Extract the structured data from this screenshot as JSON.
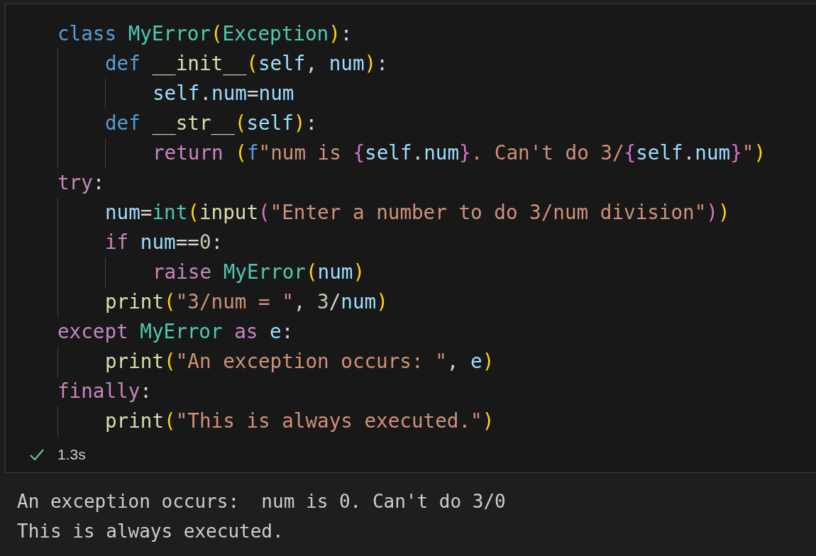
{
  "cell": {
    "lines": [
      {
        "tokens": [
          {
            "kind": "keyword",
            "text": "class "
          },
          {
            "kind": "class",
            "text": "MyError"
          },
          {
            "kind": "paren1",
            "text": "("
          },
          {
            "kind": "class",
            "text": "Exception"
          },
          {
            "kind": "paren1",
            "text": ")"
          },
          {
            "kind": "plain",
            "text": ":"
          }
        ],
        "children": [
          {
            "tokens": [
              {
                "kind": "keyword",
                "text": "def "
              },
              {
                "kind": "function",
                "text": "__init__"
              },
              {
                "kind": "paren1",
                "text": "("
              },
              {
                "kind": "variable",
                "text": "self"
              },
              {
                "kind": "plain",
                "text": ", "
              },
              {
                "kind": "variable",
                "text": "num"
              },
              {
                "kind": "paren1",
                "text": ")"
              },
              {
                "kind": "plain",
                "text": ":"
              }
            ],
            "children": [
              {
                "tokens": [
                  {
                    "kind": "variable",
                    "text": "self"
                  },
                  {
                    "kind": "plain",
                    "text": "."
                  },
                  {
                    "kind": "variable",
                    "text": "num"
                  },
                  {
                    "kind": "plain",
                    "text": "="
                  },
                  {
                    "kind": "variable",
                    "text": "num"
                  }
                ]
              }
            ]
          },
          {
            "tokens": [
              {
                "kind": "keyword",
                "text": "def "
              },
              {
                "kind": "function",
                "text": "__str__"
              },
              {
                "kind": "paren1",
                "text": "("
              },
              {
                "kind": "variable",
                "text": "self"
              },
              {
                "kind": "paren1",
                "text": ")"
              },
              {
                "kind": "plain",
                "text": ":"
              }
            ],
            "children": [
              {
                "tokens": [
                  {
                    "kind": "control",
                    "text": "return "
                  },
                  {
                    "kind": "paren1",
                    "text": "("
                  },
                  {
                    "kind": "keyword",
                    "text": "f"
                  },
                  {
                    "kind": "string",
                    "text": "\"num is "
                  },
                  {
                    "kind": "paren2",
                    "text": "{"
                  },
                  {
                    "kind": "variable",
                    "text": "self"
                  },
                  {
                    "kind": "plain",
                    "text": "."
                  },
                  {
                    "kind": "variable",
                    "text": "num"
                  },
                  {
                    "kind": "paren2",
                    "text": "}"
                  },
                  {
                    "kind": "string",
                    "text": ". Can't do 3/"
                  },
                  {
                    "kind": "paren2",
                    "text": "{"
                  },
                  {
                    "kind": "variable",
                    "text": "self"
                  },
                  {
                    "kind": "plain",
                    "text": "."
                  },
                  {
                    "kind": "variable",
                    "text": "num"
                  },
                  {
                    "kind": "paren2",
                    "text": "}"
                  },
                  {
                    "kind": "string",
                    "text": "\""
                  },
                  {
                    "kind": "paren1",
                    "text": ")"
                  }
                ]
              }
            ]
          }
        ]
      },
      {
        "tokens": [
          {
            "kind": "control",
            "text": "try"
          },
          {
            "kind": "plain",
            "text": ":"
          }
        ],
        "children": [
          {
            "tokens": [
              {
                "kind": "variable",
                "text": "num"
              },
              {
                "kind": "plain",
                "text": "="
              },
              {
                "kind": "class",
                "text": "int"
              },
              {
                "kind": "paren1",
                "text": "("
              },
              {
                "kind": "function",
                "text": "input"
              },
              {
                "kind": "paren2",
                "text": "("
              },
              {
                "kind": "string",
                "text": "\"Enter a number to do 3/num division\""
              },
              {
                "kind": "paren2",
                "text": ")"
              },
              {
                "kind": "paren1",
                "text": ")"
              }
            ]
          },
          {
            "tokens": [
              {
                "kind": "control",
                "text": "if "
              },
              {
                "kind": "variable",
                "text": "num"
              },
              {
                "kind": "plain",
                "text": "=="
              },
              {
                "kind": "number",
                "text": "0"
              },
              {
                "kind": "plain",
                "text": ":"
              }
            ],
            "children": [
              {
                "tokens": [
                  {
                    "kind": "control",
                    "text": "raise "
                  },
                  {
                    "kind": "class",
                    "text": "MyError"
                  },
                  {
                    "kind": "paren1",
                    "text": "("
                  },
                  {
                    "kind": "variable",
                    "text": "num"
                  },
                  {
                    "kind": "paren1",
                    "text": ")"
                  }
                ]
              }
            ]
          },
          {
            "tokens": [
              {
                "kind": "function",
                "text": "print"
              },
              {
                "kind": "paren1",
                "text": "("
              },
              {
                "kind": "string",
                "text": "\"3/num = \""
              },
              {
                "kind": "plain",
                "text": ", "
              },
              {
                "kind": "number",
                "text": "3"
              },
              {
                "kind": "plain",
                "text": "/"
              },
              {
                "kind": "variable",
                "text": "num"
              },
              {
                "kind": "paren1",
                "text": ")"
              }
            ]
          }
        ]
      },
      {
        "tokens": [
          {
            "kind": "control",
            "text": "except "
          },
          {
            "kind": "class",
            "text": "MyError"
          },
          {
            "kind": "control",
            "text": " as "
          },
          {
            "kind": "variable",
            "text": "e"
          },
          {
            "kind": "plain",
            "text": ":"
          }
        ],
        "children": [
          {
            "tokens": [
              {
                "kind": "function",
                "text": "print"
              },
              {
                "kind": "paren1",
                "text": "("
              },
              {
                "kind": "string",
                "text": "\"An exception occurs: \""
              },
              {
                "kind": "plain",
                "text": ", "
              },
              {
                "kind": "variable",
                "text": "e"
              },
              {
                "kind": "paren1",
                "text": ")"
              }
            ]
          }
        ]
      },
      {
        "tokens": [
          {
            "kind": "control",
            "text": "finally"
          },
          {
            "kind": "plain",
            "text": ":"
          }
        ],
        "children": [
          {
            "tokens": [
              {
                "kind": "function",
                "text": "print"
              },
              {
                "kind": "paren1",
                "text": "("
              },
              {
                "kind": "string",
                "text": "\"This is always executed.\""
              },
              {
                "kind": "paren1",
                "text": ")"
              }
            ]
          }
        ]
      }
    ],
    "status": {
      "succeeded": true,
      "duration": "1.3s"
    }
  },
  "output": [
    "An exception occurs:  num is 0. Can't do 3/0",
    "This is always executed."
  ]
}
